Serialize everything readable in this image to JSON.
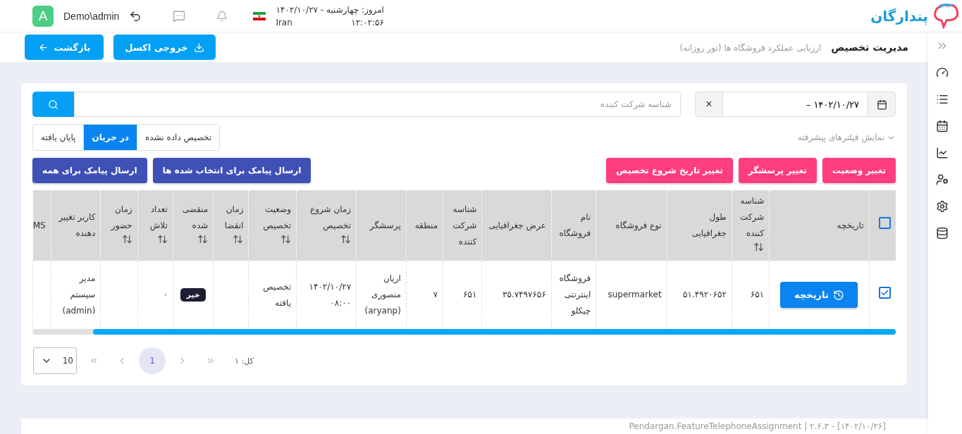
{
  "header": {
    "avatar": "A",
    "user": "Demo\\admin",
    "date_line": "امروز: چهارشنبه - ۱۴۰۲/۱۰/۲۷",
    "country": "Iran",
    "time": "۱۲:۰۲:۵۶",
    "logo_text": "پندارگان"
  },
  "page": {
    "title": "مدیریت تخصیص",
    "subtitle": "ارزیابی عملکرد فروشگاه ها (تور روزانه)",
    "buttons": [
      {
        "label": "خروجی اکسل",
        "kind": "download"
      },
      {
        "label": "بازگشت",
        "kind": "back"
      }
    ]
  },
  "filters": {
    "date_value": "۱۴۰۲/۱۰/۲۷ –",
    "clear": "×",
    "search_placeholder": "شناسه شرکت کننده",
    "advanced": "نمایش فیلترهای پیشرفته",
    "tabs": [
      {
        "label": "تخصیص داده نشده",
        "selected": false
      },
      {
        "label": "در جریان",
        "selected": true
      },
      {
        "label": "پایان یافته",
        "selected": false
      }
    ]
  },
  "actions": {
    "primary": [
      "تغییر وضعیت",
      "تغییر پرسشگر",
      "تغییر تاریخ شروع تخصیص"
    ],
    "sms": [
      "ارسال پیامک برای انتخاب شده ها",
      "ارسال پیامک برای همه"
    ]
  },
  "table": {
    "header_checked": false,
    "columns": [
      {
        "kind": "checkbox"
      },
      {
        "label": "تاریخچه",
        "sortable": false
      },
      {
        "label": "شناسه شرکت کننده",
        "sortable": true
      },
      {
        "label": "طول جغرافیایی",
        "sortable": false
      },
      {
        "label": "نوع فروشگاه",
        "sortable": false
      },
      {
        "label": "نام فروشگاه",
        "sortable": false
      },
      {
        "label": "عرض جغرافیایی",
        "sortable": false
      },
      {
        "label": "شناسه شرکت کننده",
        "sortable": false
      },
      {
        "label": "منطقه",
        "sortable": false
      },
      {
        "label": "پرسشگر",
        "sortable": false
      },
      {
        "label": "زمان شروع تخصیص",
        "sortable": true
      },
      {
        "label": "وضعیت تخصیص",
        "sortable": true
      },
      {
        "label": "زمان انقضا",
        "sortable": true
      },
      {
        "label": "منقضی شده",
        "sortable": true
      },
      {
        "label": "تعداد تلاش",
        "sortable": true
      },
      {
        "label": "زمان حضور",
        "sortable": true
      },
      {
        "label": "کاربر تغییر دهنده",
        "sortable": false
      },
      {
        "label": "MS",
        "sortable": false
      }
    ],
    "rows": [
      {
        "cells": [
          {
            "kind": "checkbox",
            "checked": true
          },
          {
            "kind": "button",
            "text": "تاریخچه"
          },
          {
            "kind": "text",
            "text": "۶۵۱"
          },
          {
            "kind": "text",
            "text": "۵۱.۴۹۲۰۶۵۲"
          },
          {
            "kind": "text",
            "text": "supermarket"
          },
          {
            "kind": "text",
            "text": "فروشگاه اینترنتی چیکلو"
          },
          {
            "kind": "text",
            "text": "۳۵.۷۴۹۷۶۵۶"
          },
          {
            "kind": "text",
            "text": "۶۵۱"
          },
          {
            "kind": "text",
            "text": "۷"
          },
          {
            "kind": "text",
            "text": "اریان منصوری (aryanp)"
          },
          {
            "kind": "text",
            "text": "۱۴۰۲/۱۰/۲۷ ۰۸:۰۰"
          },
          {
            "kind": "text",
            "text": "تخصیص یافته"
          },
          {
            "kind": "text",
            "text": ""
          },
          {
            "kind": "badge",
            "text": "خیر"
          },
          {
            "kind": "text",
            "text": "۰"
          },
          {
            "kind": "text",
            "text": ""
          },
          {
            "kind": "text",
            "text": "مدیر سیستم (admin)"
          },
          {
            "kind": "text",
            "text": ""
          }
        ]
      }
    ]
  },
  "pagination": {
    "page_size": "10",
    "pages": [
      {
        "label": "1",
        "selected": true
      }
    ],
    "total": "کل: ۱"
  },
  "footer": "Pendargan.FeatureTelephoneAssignment | ۲.۶.۳ - [۱۴۰۲/۱۰/۲۶]"
}
